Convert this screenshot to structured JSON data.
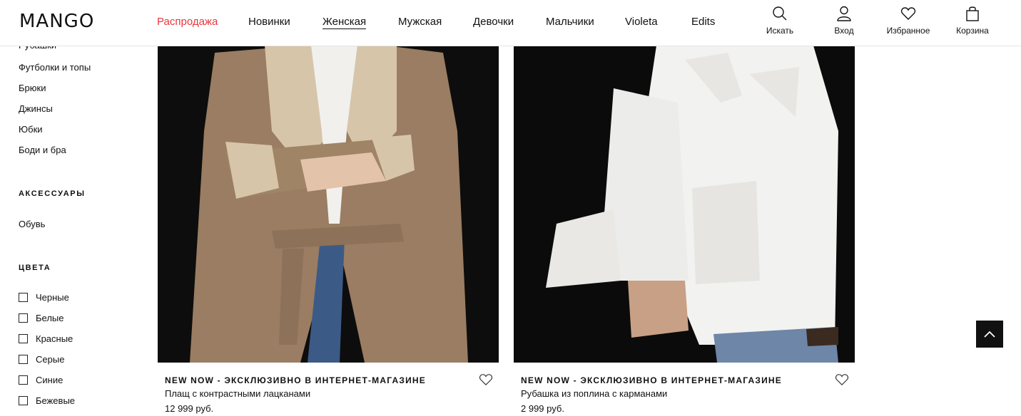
{
  "brand": {
    "logo_text": "MANGO"
  },
  "nav": {
    "items": [
      {
        "label": "Распродажа"
      },
      {
        "label": "Новинки"
      },
      {
        "label": "Женская"
      },
      {
        "label": "Мужская"
      },
      {
        "label": "Девочки"
      },
      {
        "label": "Мальчики"
      },
      {
        "label": "Violeta"
      },
      {
        "label": "Edits"
      }
    ],
    "sale_color": "#e8363d"
  },
  "header_actions": {
    "search": {
      "label": "Искать",
      "icon": "search-icon"
    },
    "login": {
      "label": "Вход",
      "icon": "user-icon"
    },
    "favorites": {
      "label": "Избранное",
      "icon": "heart-icon"
    },
    "cart": {
      "label": "Корзина",
      "icon": "bag-icon"
    }
  },
  "sidebar": {
    "categories": [
      {
        "label": "Рубашки"
      },
      {
        "label": "Футболки и топы"
      },
      {
        "label": "Брюки"
      },
      {
        "label": "Джинсы"
      },
      {
        "label": "Юбки"
      },
      {
        "label": "Боди и бра"
      }
    ],
    "accessories_heading": "АКСЕССУАРЫ",
    "accessories": [
      {
        "label": "Обувь"
      }
    ],
    "colors_heading": "ЦВЕТА",
    "colors": [
      {
        "label": "Черные"
      },
      {
        "label": "Белые"
      },
      {
        "label": "Красные"
      },
      {
        "label": "Серые"
      },
      {
        "label": "Синие"
      },
      {
        "label": "Бежевые"
      }
    ]
  },
  "products": [
    {
      "tag": "NEW NOW - ЭКСКЛЮЗИВНО В ИНТЕРНЕТ-МАГАЗИНЕ",
      "name": "Плащ с контрастными лацканами",
      "price": "12 999 руб."
    },
    {
      "tag": "NEW NOW - ЭКСКЛЮЗИВНО В ИНТЕРНЕТ-МАГАЗИНЕ",
      "name": "Рубашка из поплина с карманами",
      "price": "2 999 руб."
    }
  ],
  "back_to_top": {
    "icon": "chevron-up-icon"
  }
}
